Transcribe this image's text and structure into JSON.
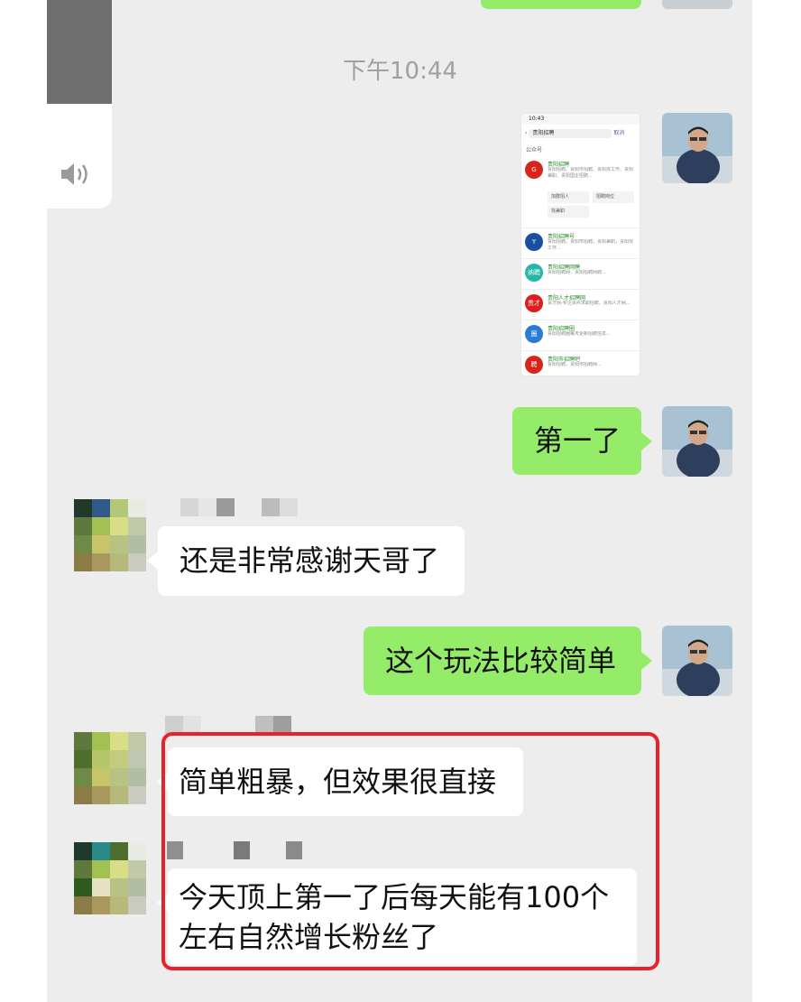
{
  "timestamp": "下午10:44",
  "voice_card": {
    "icon": "speaker-icon"
  },
  "messages": [
    {
      "id": "img",
      "side": "right",
      "type": "image"
    },
    {
      "id": "m1",
      "side": "right",
      "text": "第一了"
    },
    {
      "id": "m2",
      "side": "left",
      "text": "还是非常感谢天哥了"
    },
    {
      "id": "m3",
      "side": "right",
      "text": "这个玩法比较简单"
    },
    {
      "id": "m4",
      "side": "left",
      "text": "简单粗暴，但效果很直接"
    },
    {
      "id": "m5",
      "side": "left",
      "text": "今天顶上第一了后每天能有100个左右自然增长粉丝了"
    }
  ],
  "screenshot": {
    "time": "10:43",
    "search_text": "贵阳招聘",
    "cancel": "取消",
    "section": "公众号",
    "buttons": [
      "加群招人",
      "招聘岗位",
      "找兼职"
    ],
    "results": [
      {
        "name": "贵阳招聘",
        "desc": "贵阳招聘、贵阳市招聘、贵阳找工作、贵阳兼职、贵阳国企招聘...",
        "logo_color": "#d9241b",
        "logo_text": "G"
      },
      {
        "name": "贵阳招聘号",
        "desc": "贵阳招聘，贵阳市招聘，贵阳兼职，贵阳找工作...",
        "logo_color": "#1a4fa0",
        "logo_text": "Y"
      },
      {
        "name": "贵阳招聘网聘",
        "desc": "贵阳招聘网、贵阳招聘网聘...",
        "logo_color": "#27b7a6",
        "logo_text": "纳聘"
      },
      {
        "name": "贵阳人才招聘网",
        "desc": "贵才网-专注贵州求职招聘，贵阳人才网...",
        "logo_color": "#e01c1c",
        "logo_text": "贵才网"
      },
      {
        "name": "贵阳招聘圈",
        "desc": "贵阳招聘圈每天更新招聘信息...",
        "logo_color": "#2a7bd4",
        "logo_text": "圈"
      },
      {
        "name": "贵阳市招聘吧",
        "desc": "贵阳招聘，贵阳市招聘网...",
        "logo_color": "#d9241b",
        "logo_text": "聘"
      }
    ]
  },
  "colors": {
    "bubble_green": "#95ec69",
    "background": "#ededed",
    "highlight": "#e8212b"
  }
}
